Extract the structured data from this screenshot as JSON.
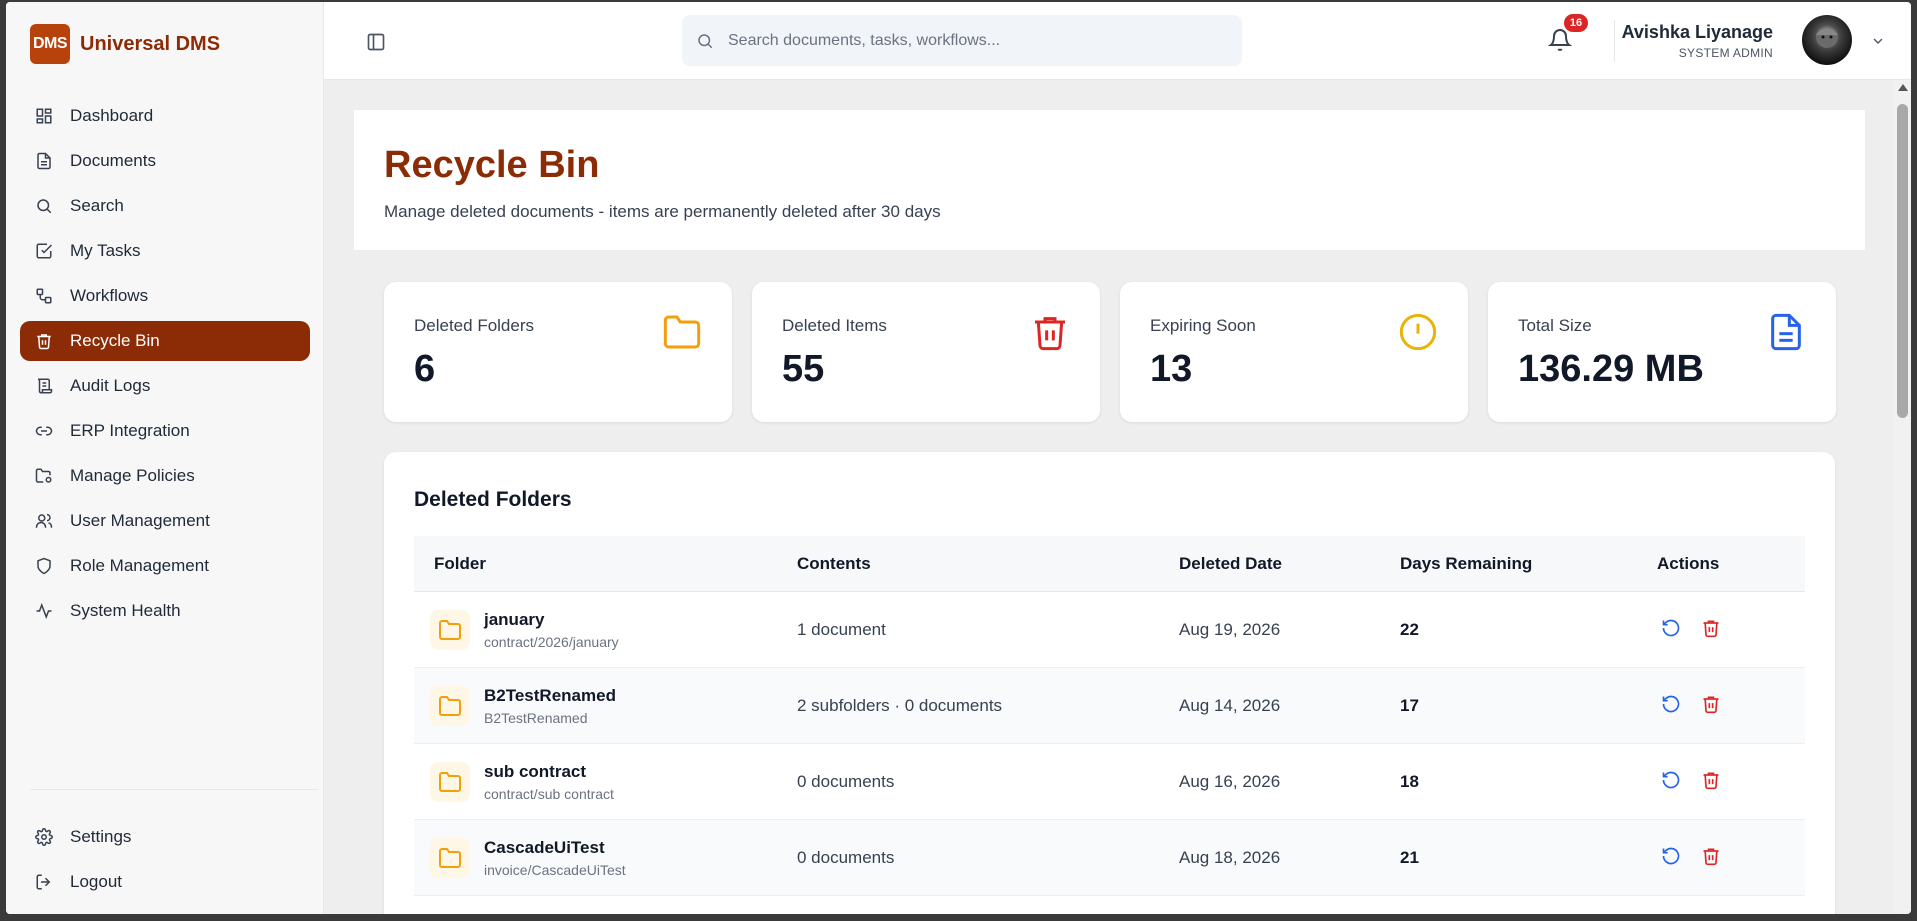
{
  "brand": {
    "logo": "DMS",
    "name": "Universal DMS"
  },
  "sidebar": {
    "items": [
      {
        "label": "Dashboard",
        "icon": "dashboard-icon"
      },
      {
        "label": "Documents",
        "icon": "document-icon"
      },
      {
        "label": "Search",
        "icon": "search-icon"
      },
      {
        "label": "My Tasks",
        "icon": "checkbox-icon"
      },
      {
        "label": "Workflows",
        "icon": "workflow-icon"
      },
      {
        "label": "Recycle Bin",
        "icon": "trash-icon",
        "active": true
      },
      {
        "label": "Audit Logs",
        "icon": "scroll-icon"
      },
      {
        "label": "ERP Integration",
        "icon": "link-icon"
      },
      {
        "label": "Manage Policies",
        "icon": "folder-gear-icon"
      },
      {
        "label": "User Management",
        "icon": "users-icon"
      },
      {
        "label": "Role Management",
        "icon": "shield-icon"
      },
      {
        "label": "System Health",
        "icon": "pulse-icon"
      }
    ],
    "bottom": [
      {
        "label": "Settings",
        "icon": "gear-icon"
      },
      {
        "label": "Logout",
        "icon": "logout-icon"
      }
    ]
  },
  "header": {
    "search_placeholder": "Search documents, tasks, workflows...",
    "notification_count": "16",
    "user_name": "Avishka Liyanage",
    "user_role": "SYSTEM ADMIN"
  },
  "page": {
    "title": "Recycle Bin",
    "subtitle": "Manage deleted documents - items are permanently deleted after 30 days"
  },
  "stats": [
    {
      "label": "Deleted Folders",
      "value": "6",
      "icon": "folder-icon",
      "color": "#f59e0b"
    },
    {
      "label": "Deleted Items",
      "value": "55",
      "icon": "trash-icon",
      "color": "#dc2626"
    },
    {
      "label": "Expiring Soon",
      "value": "13",
      "icon": "alert-circle-icon",
      "color": "#eab308"
    },
    {
      "label": "Total Size",
      "value": "136.29 MB",
      "icon": "file-text-icon",
      "color": "#2563eb"
    }
  ],
  "folders_table": {
    "title": "Deleted Folders",
    "columns": [
      "Folder",
      "Contents",
      "Deleted Date",
      "Days Remaining",
      "Actions"
    ],
    "rows": [
      {
        "name": "january",
        "path": "contract/2026/january",
        "contents": "1 document",
        "deleted_date": "Aug 19, 2026",
        "days": "22"
      },
      {
        "name": "B2TestRenamed",
        "path": "B2TestRenamed",
        "contents": "2 subfolders · 0 documents",
        "deleted_date": "Aug 14, 2026",
        "days": "17"
      },
      {
        "name": "sub contract",
        "path": "contract/sub contract",
        "contents": "0 documents",
        "deleted_date": "Aug 16, 2026",
        "days": "18"
      },
      {
        "name": "CascadeUiTest",
        "path": "invoice/CascadeUiTest",
        "contents": "0 documents",
        "deleted_date": "Aug 18, 2026",
        "days": "21"
      }
    ]
  },
  "colors": {
    "brand": "#8b2c06",
    "restore": "#2563eb",
    "delete": "#dc2626"
  }
}
